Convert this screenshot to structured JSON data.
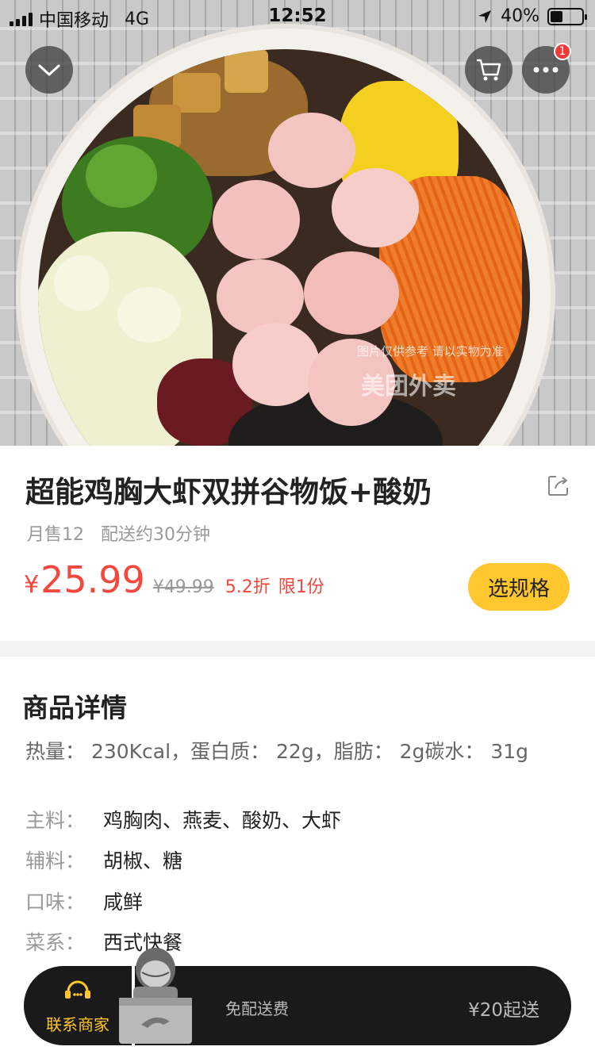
{
  "status_bar": {
    "carrier": "中国移动",
    "network": "4G",
    "time": "12:52",
    "battery_percent": "40%",
    "battery_level": 0.4
  },
  "hero": {
    "watermark_text": "图片仅供参考 请以实物为准",
    "watermark_logo": "美团外卖",
    "collapse_icon": "chevron-down-icon",
    "cart_icon": "cart-icon",
    "more_icon": "more-dots-icon",
    "more_badge": "1"
  },
  "product": {
    "title": "超能鸡胸大虾双拼谷物饭+酸奶",
    "monthly_sales": "月售12",
    "delivery_time": "配送约30分钟",
    "price_currency": "¥",
    "price": "25.99",
    "original_price": "¥49.99",
    "discount": "5.2折",
    "limit": "限1份",
    "spec_button": "选规格",
    "share_icon": "share-icon"
  },
  "details": {
    "heading": "商品详情",
    "nutrition": "热量： 230Kcal，蛋白质： 22g，脂肪： 2g碳水： 31g",
    "rows": [
      {
        "key": "主料：",
        "value": "鸡胸肉、燕麦、酸奶、大虾"
      },
      {
        "key": "辅料：",
        "value": "胡椒、糖"
      },
      {
        "key": "口味：",
        "value": "咸鲜"
      },
      {
        "key": "菜系：",
        "value": "西式快餐"
      }
    ]
  },
  "bottom_bar": {
    "contact_label": "联系商家",
    "delivery_fee": "免配送费",
    "min_order": "¥20起送"
  },
  "colors": {
    "accent_yellow": "#ffc62e",
    "price_red": "#f5473c",
    "bar_dark": "#1a1a1a"
  }
}
